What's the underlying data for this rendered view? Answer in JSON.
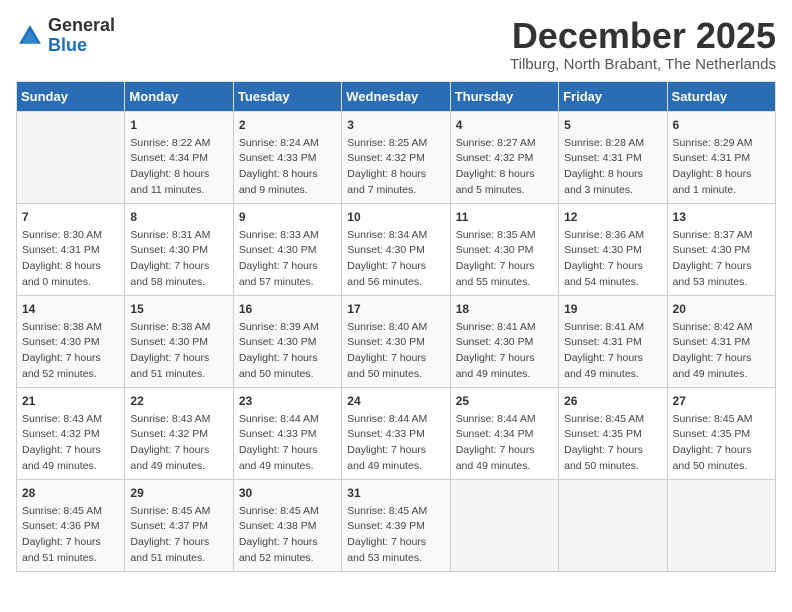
{
  "logo": {
    "general": "General",
    "blue": "Blue"
  },
  "header": {
    "month": "December 2025",
    "location": "Tilburg, North Brabant, The Netherlands"
  },
  "weekdays": [
    "Sunday",
    "Monday",
    "Tuesday",
    "Wednesday",
    "Thursday",
    "Friday",
    "Saturday"
  ],
  "weeks": [
    [
      {
        "day": "",
        "info": ""
      },
      {
        "day": "1",
        "info": "Sunrise: 8:22 AM\nSunset: 4:34 PM\nDaylight: 8 hours\nand 11 minutes."
      },
      {
        "day": "2",
        "info": "Sunrise: 8:24 AM\nSunset: 4:33 PM\nDaylight: 8 hours\nand 9 minutes."
      },
      {
        "day": "3",
        "info": "Sunrise: 8:25 AM\nSunset: 4:32 PM\nDaylight: 8 hours\nand 7 minutes."
      },
      {
        "day": "4",
        "info": "Sunrise: 8:27 AM\nSunset: 4:32 PM\nDaylight: 8 hours\nand 5 minutes."
      },
      {
        "day": "5",
        "info": "Sunrise: 8:28 AM\nSunset: 4:31 PM\nDaylight: 8 hours\nand 3 minutes."
      },
      {
        "day": "6",
        "info": "Sunrise: 8:29 AM\nSunset: 4:31 PM\nDaylight: 8 hours\nand 1 minute."
      }
    ],
    [
      {
        "day": "7",
        "info": "Sunrise: 8:30 AM\nSunset: 4:31 PM\nDaylight: 8 hours\nand 0 minutes."
      },
      {
        "day": "8",
        "info": "Sunrise: 8:31 AM\nSunset: 4:30 PM\nDaylight: 7 hours\nand 58 minutes."
      },
      {
        "day": "9",
        "info": "Sunrise: 8:33 AM\nSunset: 4:30 PM\nDaylight: 7 hours\nand 57 minutes."
      },
      {
        "day": "10",
        "info": "Sunrise: 8:34 AM\nSunset: 4:30 PM\nDaylight: 7 hours\nand 56 minutes."
      },
      {
        "day": "11",
        "info": "Sunrise: 8:35 AM\nSunset: 4:30 PM\nDaylight: 7 hours\nand 55 minutes."
      },
      {
        "day": "12",
        "info": "Sunrise: 8:36 AM\nSunset: 4:30 PM\nDaylight: 7 hours\nand 54 minutes."
      },
      {
        "day": "13",
        "info": "Sunrise: 8:37 AM\nSunset: 4:30 PM\nDaylight: 7 hours\nand 53 minutes."
      }
    ],
    [
      {
        "day": "14",
        "info": "Sunrise: 8:38 AM\nSunset: 4:30 PM\nDaylight: 7 hours\nand 52 minutes."
      },
      {
        "day": "15",
        "info": "Sunrise: 8:38 AM\nSunset: 4:30 PM\nDaylight: 7 hours\nand 51 minutes."
      },
      {
        "day": "16",
        "info": "Sunrise: 8:39 AM\nSunset: 4:30 PM\nDaylight: 7 hours\nand 50 minutes."
      },
      {
        "day": "17",
        "info": "Sunrise: 8:40 AM\nSunset: 4:30 PM\nDaylight: 7 hours\nand 50 minutes."
      },
      {
        "day": "18",
        "info": "Sunrise: 8:41 AM\nSunset: 4:30 PM\nDaylight: 7 hours\nand 49 minutes."
      },
      {
        "day": "19",
        "info": "Sunrise: 8:41 AM\nSunset: 4:31 PM\nDaylight: 7 hours\nand 49 minutes."
      },
      {
        "day": "20",
        "info": "Sunrise: 8:42 AM\nSunset: 4:31 PM\nDaylight: 7 hours\nand 49 minutes."
      }
    ],
    [
      {
        "day": "21",
        "info": "Sunrise: 8:43 AM\nSunset: 4:32 PM\nDaylight: 7 hours\nand 49 minutes."
      },
      {
        "day": "22",
        "info": "Sunrise: 8:43 AM\nSunset: 4:32 PM\nDaylight: 7 hours\nand 49 minutes."
      },
      {
        "day": "23",
        "info": "Sunrise: 8:44 AM\nSunset: 4:33 PM\nDaylight: 7 hours\nand 49 minutes."
      },
      {
        "day": "24",
        "info": "Sunrise: 8:44 AM\nSunset: 4:33 PM\nDaylight: 7 hours\nand 49 minutes."
      },
      {
        "day": "25",
        "info": "Sunrise: 8:44 AM\nSunset: 4:34 PM\nDaylight: 7 hours\nand 49 minutes."
      },
      {
        "day": "26",
        "info": "Sunrise: 8:45 AM\nSunset: 4:35 PM\nDaylight: 7 hours\nand 50 minutes."
      },
      {
        "day": "27",
        "info": "Sunrise: 8:45 AM\nSunset: 4:35 PM\nDaylight: 7 hours\nand 50 minutes."
      }
    ],
    [
      {
        "day": "28",
        "info": "Sunrise: 8:45 AM\nSunset: 4:36 PM\nDaylight: 7 hours\nand 51 minutes."
      },
      {
        "day": "29",
        "info": "Sunrise: 8:45 AM\nSunset: 4:37 PM\nDaylight: 7 hours\nand 51 minutes."
      },
      {
        "day": "30",
        "info": "Sunrise: 8:45 AM\nSunset: 4:38 PM\nDaylight: 7 hours\nand 52 minutes."
      },
      {
        "day": "31",
        "info": "Sunrise: 8:45 AM\nSunset: 4:39 PM\nDaylight: 7 hours\nand 53 minutes."
      },
      {
        "day": "",
        "info": ""
      },
      {
        "day": "",
        "info": ""
      },
      {
        "day": "",
        "info": ""
      }
    ]
  ]
}
